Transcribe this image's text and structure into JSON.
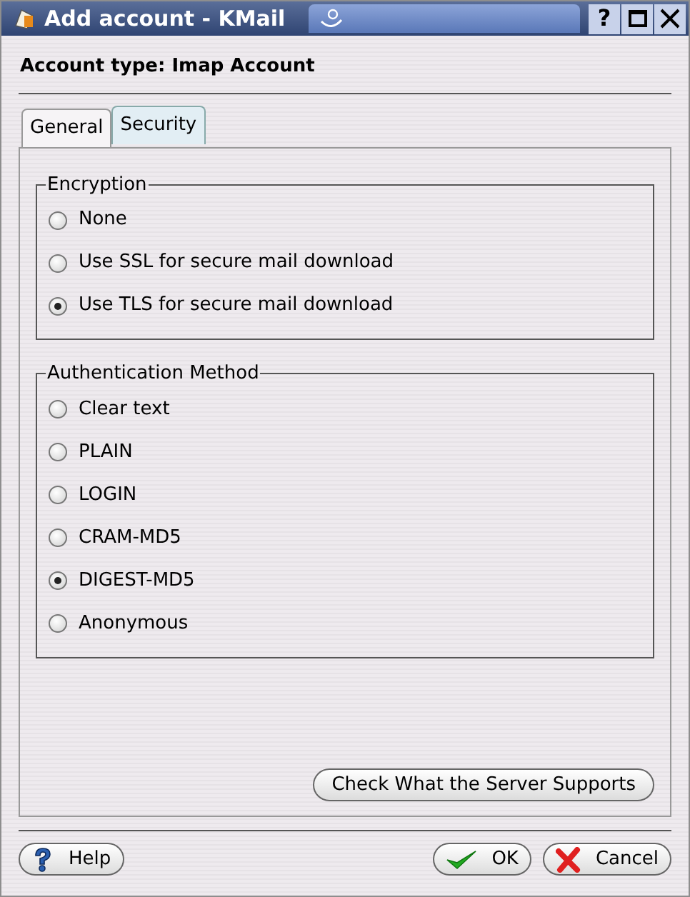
{
  "window": {
    "title": "Add account - KMail"
  },
  "title_buttons": [
    "?"
  ],
  "account_type": "Account type: Imap Account",
  "tabs": [
    {
      "label": "General",
      "selected": false
    },
    {
      "label": "Security",
      "selected": true
    }
  ],
  "groups": [
    {
      "title": "Encryption",
      "options": [
        {
          "label": "None",
          "selected": false
        },
        {
          "label": "Use SSL for secure mail download",
          "selected": false
        },
        {
          "label": "Use TLS for secure mail download",
          "selected": true
        }
      ]
    },
    {
      "title": "Authentication Method",
      "options": [
        {
          "label": "Clear text",
          "selected": false
        },
        {
          "label": "PLAIN",
          "selected": false
        },
        {
          "label": "LOGIN",
          "selected": false
        },
        {
          "label": "CRAM-MD5",
          "selected": false
        },
        {
          "label": "DIGEST-MD5",
          "selected": true
        },
        {
          "label": "Anonymous",
          "selected": false
        }
      ]
    }
  ],
  "check_button": "Check What the Server Supports",
  "buttons": [
    {
      "kind": "help",
      "label": "Help"
    },
    {
      "kind": "ok",
      "label": "OK"
    },
    {
      "kind": "cancel",
      "label": "Cancel"
    }
  ]
}
